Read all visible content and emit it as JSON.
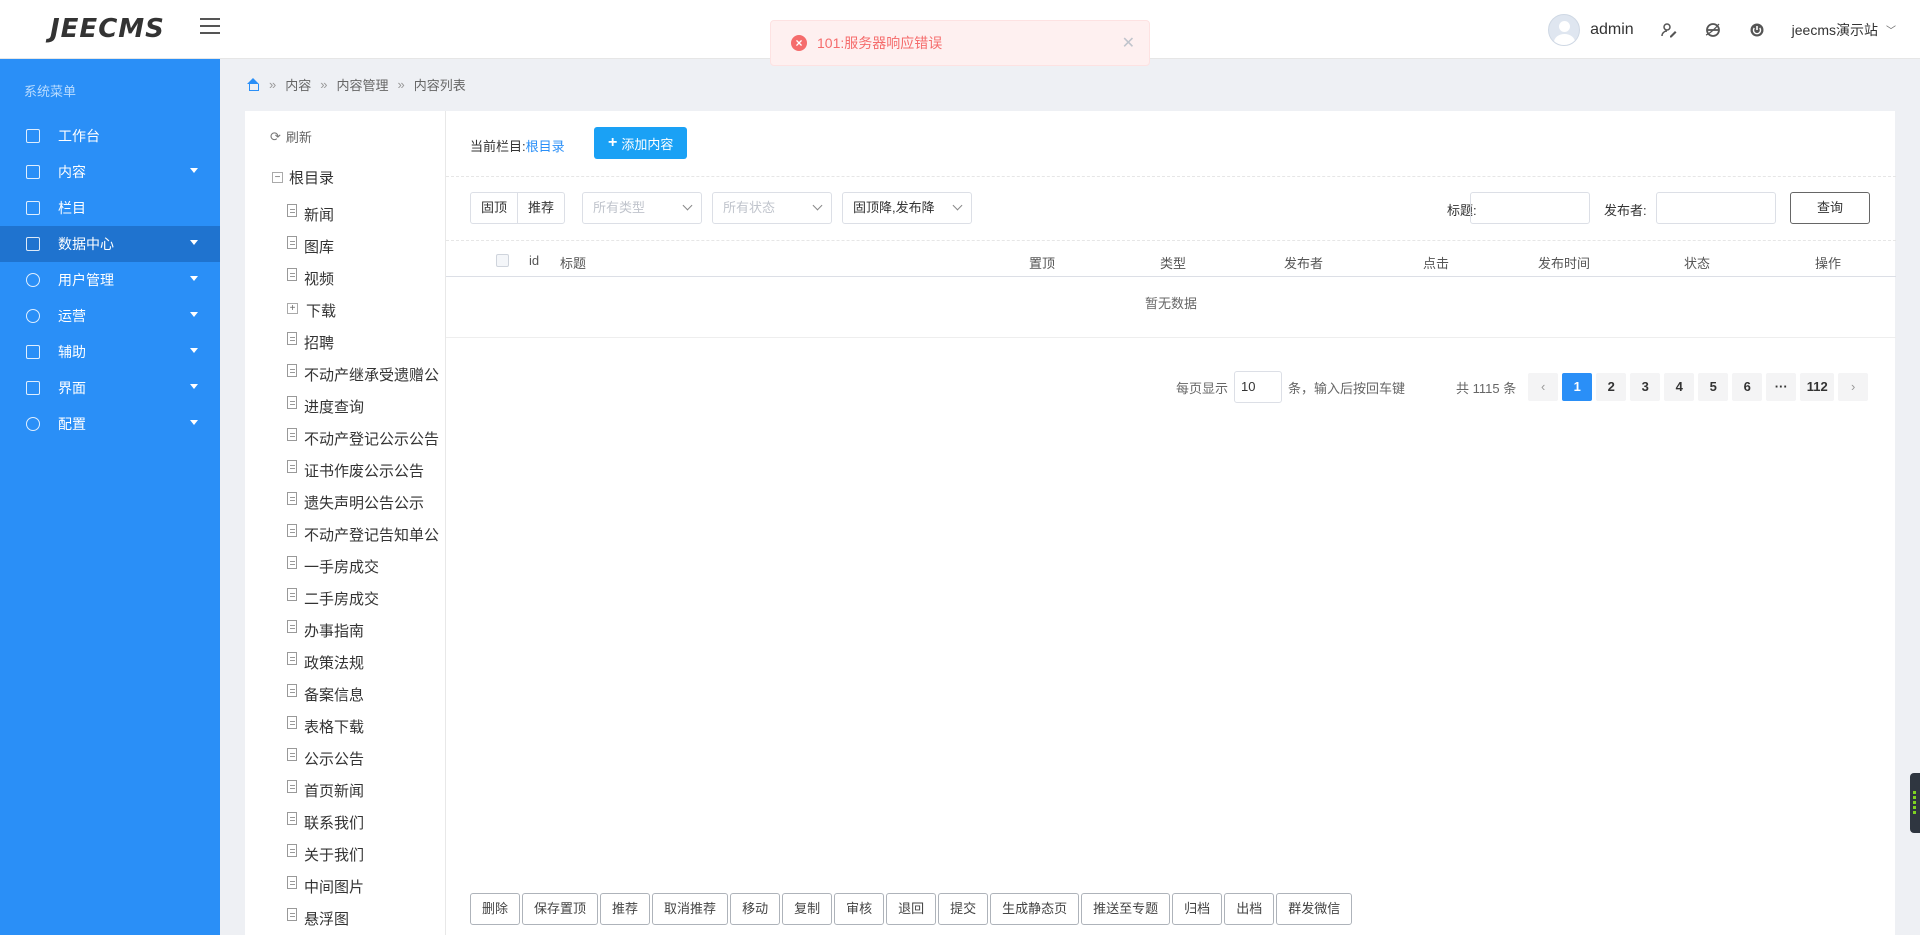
{
  "app": {
    "logo": "JEECMS"
  },
  "header": {
    "username": "admin",
    "site_name": "jeecms演示站",
    "icons": [
      "user-edit-icon",
      "browser-icon",
      "power-icon"
    ]
  },
  "toast": {
    "message": "101:服务器响应错误",
    "type": "error"
  },
  "sidebar": {
    "title": "系统菜单",
    "items": [
      {
        "label": "工作台",
        "icon": "monitor-icon",
        "has_children": false,
        "active": false
      },
      {
        "label": "内容",
        "icon": "document-icon",
        "has_children": true,
        "active": false
      },
      {
        "label": "栏目",
        "icon": "grid-icon",
        "has_children": false,
        "active": false
      },
      {
        "label": "数据中心",
        "icon": "bar-chart-icon",
        "has_children": true,
        "active": true
      },
      {
        "label": "用户管理",
        "icon": "user-icon",
        "has_children": true,
        "active": false
      },
      {
        "label": "运营",
        "icon": "shield-icon",
        "has_children": true,
        "active": false
      },
      {
        "label": "辅助",
        "icon": "briefcase-icon",
        "has_children": true,
        "active": false
      },
      {
        "label": "界面",
        "icon": "layout-icon",
        "has_children": true,
        "active": false
      },
      {
        "label": "配置",
        "icon": "gear-icon",
        "has_children": true,
        "active": false
      }
    ]
  },
  "breadcrumb": [
    "内容",
    "内容管理",
    "内容列表"
  ],
  "tree": {
    "refresh_label": "刷新",
    "root_label": "根目录",
    "nodes": [
      {
        "label": "新闻",
        "expandable": false
      },
      {
        "label": "图库",
        "expandable": false
      },
      {
        "label": "视频",
        "expandable": false
      },
      {
        "label": "下载",
        "expandable": true
      },
      {
        "label": "招聘",
        "expandable": false
      },
      {
        "label": "不动产继承受遗赠公",
        "expandable": false
      },
      {
        "label": "进度查询",
        "expandable": false
      },
      {
        "label": "不动产登记公示公告",
        "expandable": false
      },
      {
        "label": "证书作废公示公告",
        "expandable": false
      },
      {
        "label": "遗失声明公告公示",
        "expandable": false
      },
      {
        "label": "不动产登记告知单公",
        "expandable": false
      },
      {
        "label": "一手房成交",
        "expandable": false
      },
      {
        "label": "二手房成交",
        "expandable": false
      },
      {
        "label": "办事指南",
        "expandable": false
      },
      {
        "label": "政策法规",
        "expandable": false
      },
      {
        "label": "备案信息",
        "expandable": false
      },
      {
        "label": "表格下载",
        "expandable": false
      },
      {
        "label": "公示公告",
        "expandable": false
      },
      {
        "label": "首页新闻",
        "expandable": false
      },
      {
        "label": "联系我们",
        "expandable": false
      },
      {
        "label": "关于我们",
        "expandable": false
      },
      {
        "label": "中间图片",
        "expandable": false
      },
      {
        "label": "悬浮图",
        "expandable": false
      }
    ]
  },
  "main": {
    "current_column_label": "当前栏目:",
    "current_column_value": "根目录",
    "add_button": "添加内容",
    "filters": {
      "toggle_top": "固顶",
      "toggle_recommend": "推荐",
      "type_placeholder": "所有类型",
      "status_placeholder": "所有状态",
      "sort_value": "固顶降,发布降",
      "title_label": "标题:",
      "title_value": "",
      "publisher_label": "发布者:",
      "publisher_value": "",
      "query_button": "查询"
    },
    "table": {
      "columns": [
        "id",
        "标题",
        "置顶",
        "类型",
        "发布者",
        "点击",
        "发布时间",
        "状态",
        "操作"
      ],
      "rows": [],
      "empty_text": "暂无数据"
    },
    "pagination": {
      "per_page_label": "每页显示",
      "per_page_value": "10",
      "per_page_hint": "条，输入后按回车键",
      "total_text": "共 1115 条",
      "prev": "‹",
      "pages": [
        "1",
        "2",
        "3",
        "4",
        "5",
        "6"
      ],
      "ellipsis": "···",
      "last_page": "112",
      "next": "›",
      "current_page": 1
    },
    "bulk_actions": [
      "删除",
      "保存置顶",
      "推荐",
      "取消推荐",
      "移动",
      "复制",
      "审核",
      "退回",
      "提交",
      "生成静态页",
      "推送至专题",
      "归档",
      "出档",
      "群发微信"
    ]
  },
  "colors": {
    "primary": "#2a8ff7",
    "sidebar_active": "#1f73cf",
    "error": "#f56c6c",
    "add_button": "#1aa1f5"
  }
}
